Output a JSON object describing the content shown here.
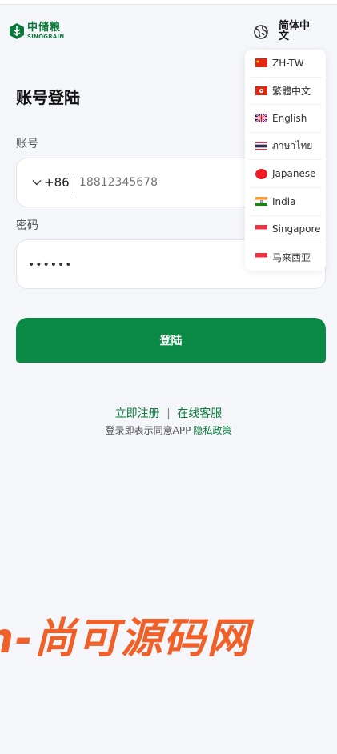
{
  "header": {
    "logo_cn": "中储粮",
    "logo_en": "SINOGRAIN",
    "current_language": "简体中文"
  },
  "language_menu": [
    {
      "label": "ZH-TW",
      "flag": "cn"
    },
    {
      "label": "繁體中文",
      "flag": "hk"
    },
    {
      "label": "English",
      "flag": "uk"
    },
    {
      "label": "ภาษาไทย",
      "flag": "th"
    },
    {
      "label": "Japanese",
      "flag": "jp"
    },
    {
      "label": "India",
      "flag": "in"
    },
    {
      "label": "Singapore",
      "flag": "sg"
    },
    {
      "label": "马来西亚",
      "flag": "my"
    }
  ],
  "form": {
    "title": "账号登陆",
    "account_label": "账号",
    "country_code": "+86",
    "phone_placeholder": "18812345678",
    "password_label": "密码",
    "password_value": "••••••",
    "login_button": "登陆"
  },
  "footer": {
    "register_link": "立即注册",
    "divider": "|",
    "service_link": "在线客服",
    "agree_text": "登录即表示同意APP",
    "policy_link": "隐私政策"
  },
  "watermark": "n-尚可源码网",
  "colors": {
    "brand_green": "#0a8a44",
    "background": "#f5f6fa",
    "watermark": "#f0612a"
  }
}
